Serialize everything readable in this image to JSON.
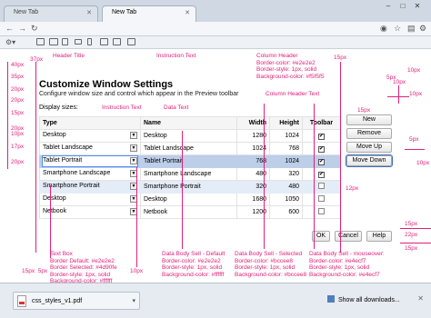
{
  "browser": {
    "tabs": [
      {
        "label": "New Tab"
      },
      {
        "label": "New Tab"
      }
    ]
  },
  "page": {
    "title": "Customize Window Settings",
    "subtitle": "Configure window size and control which appear in the Preview toolbar",
    "display_sizes_label": "Display sizes:",
    "table": {
      "headers": [
        "Type",
        "Name",
        "Width",
        "Height",
        "Toolbar"
      ],
      "rows": [
        {
          "type": "Desktop",
          "name": "Desktop",
          "width": "1280",
          "height": "1024",
          "toolbar": true
        },
        {
          "type": "Tablet Landscape",
          "name": "Tablet Landscape",
          "width": "1024",
          "height": "768",
          "toolbar": true
        },
        {
          "type": "Tablet Portrait",
          "name": "Tablet Portrait",
          "width": "768",
          "height": "1024",
          "toolbar": true
        },
        {
          "type": "Smartphone Landscape",
          "name": "Smartphone Landscape",
          "width": "480",
          "height": "320",
          "toolbar": true
        },
        {
          "type": "Smartphone Portrait",
          "name": "Smartphone Portrait",
          "width": "320",
          "height": "480",
          "toolbar": false
        },
        {
          "type": "Desktop",
          "name": "Desktop",
          "width": "1680",
          "height": "1050",
          "toolbar": false
        },
        {
          "type": "Netbook",
          "name": "Netbook",
          "width": "1200",
          "height": "600",
          "toolbar": false
        }
      ]
    },
    "side_buttons": {
      "new": "New",
      "remove": "Remove",
      "move_up": "Move Up",
      "move_down": "Move Down"
    },
    "bottom_buttons": {
      "ok": "OK",
      "cancel": "Cancel",
      "help": "Help"
    }
  },
  "annotations": {
    "header_title": "Header Title",
    "instruction_text_1": "Instruction Text",
    "instruction_text_2": "Instruction Text",
    "column_header_text": "Column Header Text",
    "data_text": "Data Text",
    "column_header_spec": [
      "Column Header",
      "Border-color: #e2e2e2",
      "Border-style: 1px, solid",
      "Background-color: #f5f5f5"
    ],
    "text_box_spec": [
      "Text Box",
      "Border Default: #e2e2e2",
      "Border Selected: #4d90fe",
      "Border-style: 1px, solid",
      "Background-color: #ffffff"
    ],
    "data_body_default_spec": [
      "Data Body Sell - Default",
      "Border-color: #e2e2e2",
      "Border-style: 1px, solid",
      "Background-color: #ffffff"
    ],
    "data_body_selected_spec": [
      "Data Body Sell - Selected",
      "Border-color: #bccee8",
      "Border-style: 1px, solid",
      "Background-color: #bccee8"
    ],
    "data_body_mouseover_spec": [
      "Data Body Sell - mouseover:",
      "Border-color: #e4ecf7",
      "Border-style: 1px, solid",
      "Background-color: #e4ecf7"
    ],
    "spacings": [
      "40px",
      "37px",
      "35px",
      "20px",
      "20px",
      "15px",
      "20px",
      "17px",
      "10px",
      "20px",
      "15px",
      "5px",
      "10px",
      "15px",
      "10px",
      "10px",
      "10px",
      "5px",
      "12px",
      "15px",
      "22px",
      "15px",
      "10px"
    ]
  },
  "download_shelf": {
    "file_name": "css_styles_v1.pdf",
    "show_all": "Show all downloads..."
  },
  "colors": {
    "annotation": "#e0207a",
    "border_default": "#e2e2e2",
    "border_selected": "#4d90fe",
    "selected_bg": "#bccee8",
    "mouseover_bg": "#e4ecf7",
    "header_bg": "#f5f5f5"
  },
  "icons": [
    "back-icon",
    "forward-icon",
    "reload-icon",
    "search-icon",
    "star-icon",
    "wrench-icon",
    "dropdown-arrow-icon",
    "checkbox-icon",
    "pdf-icon",
    "close-icon"
  ]
}
